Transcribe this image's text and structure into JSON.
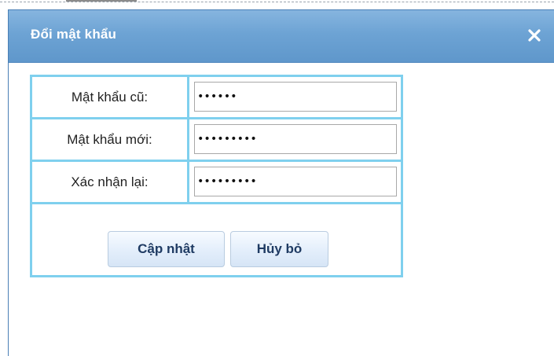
{
  "dialog": {
    "title": "Đổi mật khẩu",
    "close_icon": "close-icon"
  },
  "form": {
    "rows": [
      {
        "label": "Mật khẩu cũ:",
        "value": "••••••"
      },
      {
        "label": "Mật khẩu mới:",
        "value": "•••••••••"
      },
      {
        "label": "Xác nhận lại:",
        "value": "•••••••••"
      }
    ],
    "update_label": "Cập nhật",
    "cancel_label": "Hủy bỏ"
  },
  "colors": {
    "titlebar": "#6da3d4",
    "table_border": "#7fd0ee",
    "button_text": "#1f3b63"
  }
}
